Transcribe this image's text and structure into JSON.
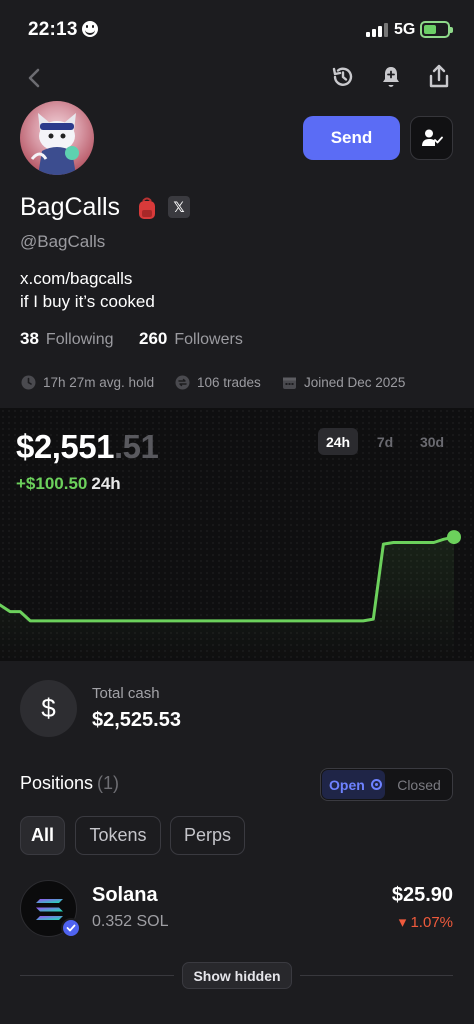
{
  "status_bar": {
    "time": "22:13",
    "network": "5G"
  },
  "profile": {
    "display_name": "BagCalls",
    "handle": "@BagCalls",
    "bio_lines": [
      "x.com/bagcalls",
      "if I buy it’s cooked"
    ],
    "following_count": "38",
    "following_label": "Following",
    "followers_count": "260",
    "followers_label": "Followers",
    "send_label": "Send",
    "x_badge": "𝕏"
  },
  "stats": {
    "avg_hold": "17h 27m avg. hold",
    "trades": "106 trades",
    "joined": "Joined Dec 2025"
  },
  "portfolio": {
    "value_whole": "$2,551",
    "value_decimal": ".51",
    "change": "+$100.50",
    "change_period": "24h",
    "ranges": [
      "24h",
      "7d",
      "30d"
    ],
    "active_range": "24h",
    "accent": "#6cd15c"
  },
  "chart_data": {
    "type": "line",
    "title": "",
    "xlabel": "",
    "ylabel": "",
    "series": [
      {
        "values": [
          2470,
          2462,
          2462,
          2451,
          2451,
          2451,
          2451,
          2451,
          2451,
          2451,
          2451,
          2451,
          2451,
          2451,
          2451,
          2451,
          2451,
          2451,
          2451,
          2451,
          2451,
          2451,
          2451,
          2451,
          2451,
          2451,
          2451,
          2451,
          2451,
          2451,
          2451,
          2451,
          2451,
          2451,
          2451,
          2451,
          2451,
          2453,
          2543,
          2545,
          2545,
          2545,
          2545,
          2545,
          2549,
          2551.51
        ]
      }
    ],
    "ylim": [
      2440,
      2560
    ],
    "grid": false,
    "color": "#6cd15c"
  },
  "cash": {
    "label": "Total cash",
    "value": "$2,525.53",
    "symbol": "$"
  },
  "positions": {
    "title": "Positions",
    "count": "(1)",
    "toggle_open": "Open",
    "toggle_closed": "Closed",
    "filters": [
      "All",
      "Tokens",
      "Perps"
    ],
    "items": [
      {
        "name": "Solana",
        "amount": "0.352 SOL",
        "value": "$25.90",
        "change": "▾ 1.07%",
        "change_color": "#ef5a3c"
      }
    ],
    "show_hidden": "Show hidden"
  }
}
